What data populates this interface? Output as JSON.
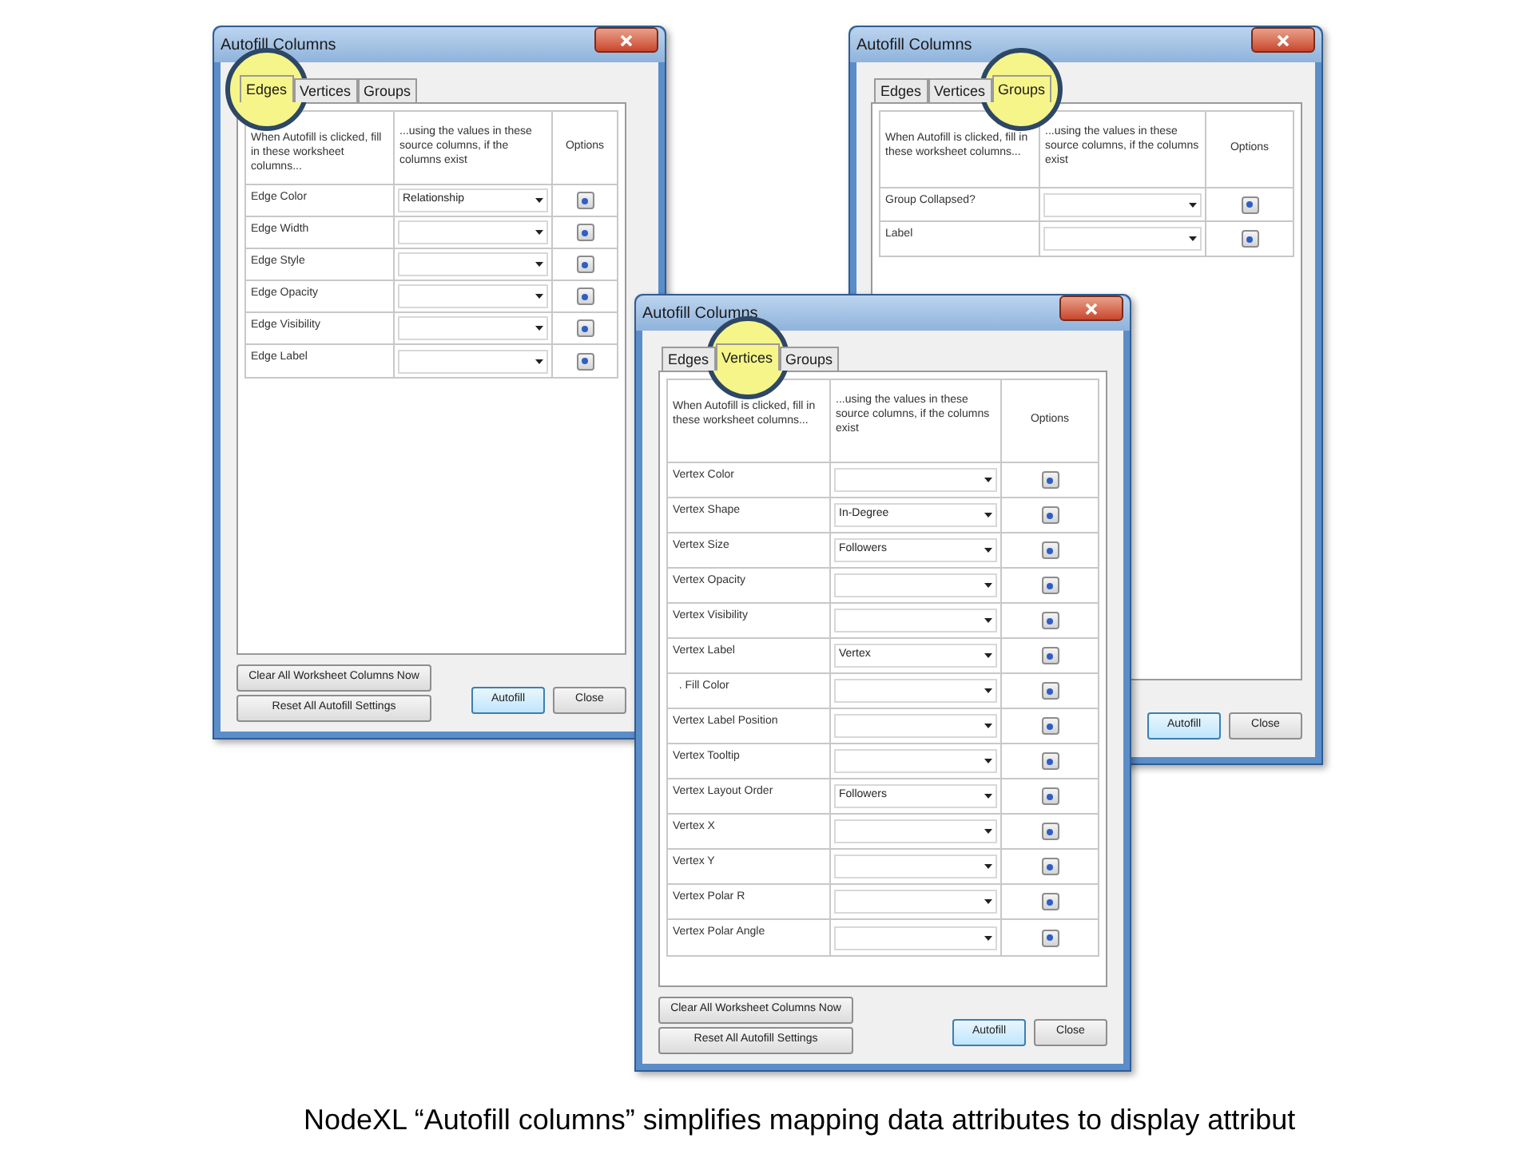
{
  "dialogs": [
    {
      "title": "Autofill Columns",
      "tabs": [
        {
          "label": "Edges",
          "selected": true
        },
        {
          "label": "Vertices",
          "selected": false
        },
        {
          "label": "Groups",
          "selected": false
        }
      ],
      "columns": [
        "When Autofill is clicked, fill in these worksheet columns...",
        "...using the values in these source columns, if the columns exist",
        "Options"
      ],
      "rows": [
        {
          "label": "Edge Color",
          "value": "Relationship"
        },
        {
          "label": "Edge Width"
        },
        {
          "label": "Edge Style"
        },
        {
          "label": "Edge Opacity"
        },
        {
          "label": "Edge Visibility"
        },
        {
          "label": "Edge Label"
        }
      ],
      "side_buttons": [
        "Clear All Worksheet Columns Now",
        "Reset All Autofill Settings"
      ],
      "buttons": [
        {
          "label": "Autofill",
          "default": true
        },
        {
          "label": "Close",
          "default": false
        }
      ]
    },
    {
      "title": "Autofill Columns",
      "tabs": [
        {
          "label": "Edges",
          "selected": false
        },
        {
          "label": "Vertices",
          "selected": false
        },
        {
          "label": "Groups",
          "selected": true
        }
      ],
      "columns": [
        "When Autofill is clicked, fill in these worksheet columns...",
        "...using the values in these source columns, if the columns exist",
        "Options"
      ],
      "rows": [
        {
          "label": "Group Collapsed?"
        },
        {
          "label": "Label"
        }
      ],
      "buttons": [
        {
          "label": "Autofill",
          "default": true
        },
        {
          "label": "Close",
          "default": false
        }
      ]
    },
    {
      "title": "Autofill Columns",
      "tabs": [
        {
          "label": "Edges",
          "selected": false
        },
        {
          "label": "Vertices",
          "selected": true
        },
        {
          "label": "Groups",
          "selected": false
        }
      ],
      "columns": [
        "When Autofill is clicked, fill in these worksheet columns...",
        "...using the values in these source columns, if the columns exist",
        "Options"
      ],
      "rows": [
        {
          "label": "Vertex Color"
        },
        {
          "label": "Vertex Shape",
          "value": "In-Degree"
        },
        {
          "label": "Vertex Size",
          "value": "Followers"
        },
        {
          "label": "Vertex Opacity"
        },
        {
          "label": "Vertex Visibility"
        },
        {
          "label": "Vertex Label",
          "value": "Vertex"
        },
        {
          "label": "  . Fill Color"
        },
        {
          "label": "Vertex Label Position"
        },
        {
          "label": "Vertex Tooltip"
        },
        {
          "label": "Vertex Layout Order",
          "value": "Followers"
        },
        {
          "label": "Vertex X"
        },
        {
          "label": "Vertex Y"
        },
        {
          "label": "Vertex Polar R"
        },
        {
          "label": "Vertex Polar Angle"
        }
      ],
      "side_buttons": [
        "Clear All Worksheet Columns Now",
        "Reset All Autofill Settings"
      ],
      "buttons": [
        {
          "label": "Autofill",
          "default": true
        },
        {
          "label": "Close",
          "default": false
        }
      ]
    }
  ],
  "caption": "NodeXL “Autofill columns” simplifies mapping data attributes to display attribut"
}
